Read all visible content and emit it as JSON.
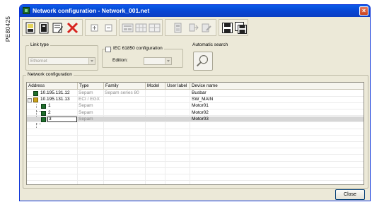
{
  "side_label": "PE80425",
  "window": {
    "title": "Network configuration - Network_001.net",
    "close_glyph": "×"
  },
  "toolbar": {
    "buttons": [
      {
        "name": "new-document-icon"
      },
      {
        "name": "open-document-icon"
      },
      {
        "name": "edit-properties-icon"
      },
      {
        "name": "delete-icon"
      },
      {
        "name": "expand-icon",
        "glyph": "+"
      },
      {
        "name": "collapse-icon",
        "glyph": "−"
      },
      {
        "name": "network-layout-icon"
      },
      {
        "name": "network-grid-icon"
      },
      {
        "name": "network-split-icon"
      },
      {
        "name": "device-properties-icon"
      },
      {
        "name": "connect-device-icon"
      },
      {
        "name": "transfer-settings-icon"
      },
      {
        "name": "save-icon"
      },
      {
        "name": "save-all-icon"
      }
    ]
  },
  "link_type": {
    "label": "Link type",
    "value": "Ethernet"
  },
  "iec": {
    "label": "IEC 61850 configuration",
    "edition_label": "Edition:",
    "edition_value": ""
  },
  "auto_search": {
    "label": "Automatic search"
  },
  "network_config": {
    "label": "Network configuration",
    "columns": [
      "Address",
      "Type",
      "Family",
      "Model",
      "User label",
      "Device name"
    ],
    "rows": [
      {
        "address": "10.195.131.12",
        "type": "Sepam",
        "family": "Sepam series 80",
        "model": "",
        "user_label": "",
        "device_name": "Busbar",
        "level": 0,
        "icon": "device",
        "selected": false
      },
      {
        "address": "10.195.131.13",
        "type": "ECI / EGX",
        "family": "",
        "model": "",
        "user_label": "",
        "device_name": "SW_MAIN",
        "level": 0,
        "icon": "gateway",
        "selected": false
      },
      {
        "address": "1",
        "type": "Sepam",
        "family": "",
        "model": "",
        "user_label": "",
        "device_name": "Motor01",
        "level": 1,
        "icon": "device",
        "selected": false
      },
      {
        "address": "2",
        "type": "Sepam",
        "family": "",
        "model": "",
        "user_label": "",
        "device_name": "Motor02",
        "level": 1,
        "icon": "device",
        "selected": false
      },
      {
        "address": "3",
        "type": "Sepam",
        "family": "",
        "model": "",
        "user_label": "",
        "device_name": "Motor03",
        "level": 1,
        "icon": "device",
        "selected": true
      }
    ]
  },
  "close_button": {
    "label": "Close"
  },
  "colors": {
    "titlebar": "#0a5ce8",
    "window_bg": "#ece9d8",
    "selected_row": "#d6d6d6",
    "device_icon": "#1e6e2b",
    "gateway_icon": "#c9a21a"
  }
}
